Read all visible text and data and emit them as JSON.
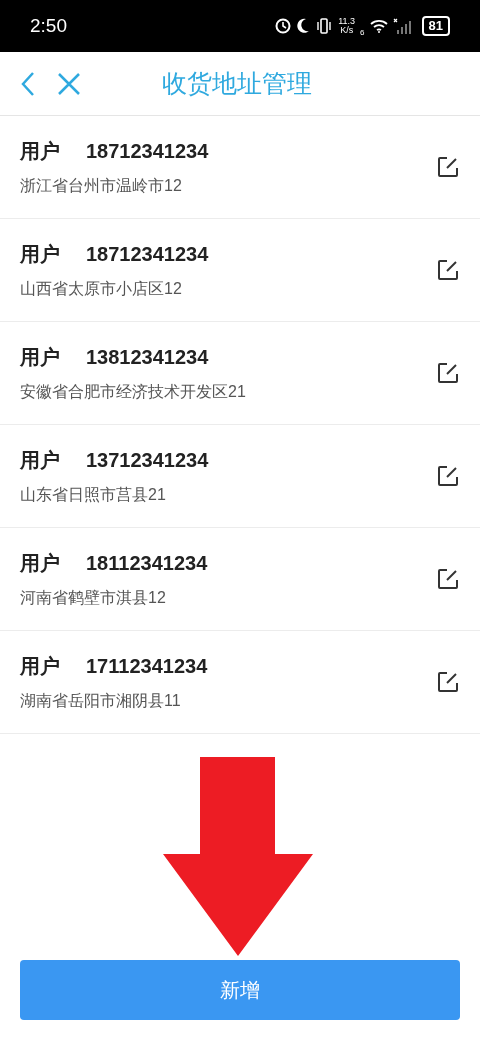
{
  "status_bar": {
    "time": "2:50",
    "speed_value": "11.3",
    "speed_unit": "K/s",
    "network": "6",
    "battery": "81"
  },
  "header": {
    "title": "收货地址管理"
  },
  "addresses": [
    {
      "name": "用户",
      "phone": "18712341234",
      "address": "浙江省台州市温岭市12"
    },
    {
      "name": "用户",
      "phone": "18712341234",
      "address": "山西省太原市小店区12"
    },
    {
      "name": "用户",
      "phone": "13812341234",
      "address": "安徽省合肥市经济技术开发区21"
    },
    {
      "name": "用户",
      "phone": "13712341234",
      "address": "山东省日照市莒县21"
    },
    {
      "name": "用户",
      "phone": "18112341234",
      "address": "河南省鹤壁市淇县12"
    },
    {
      "name": "用户",
      "phone": "17112341234",
      "address": "湖南省岳阳市湘阴县11"
    }
  ],
  "add_button": {
    "label": "新增"
  }
}
